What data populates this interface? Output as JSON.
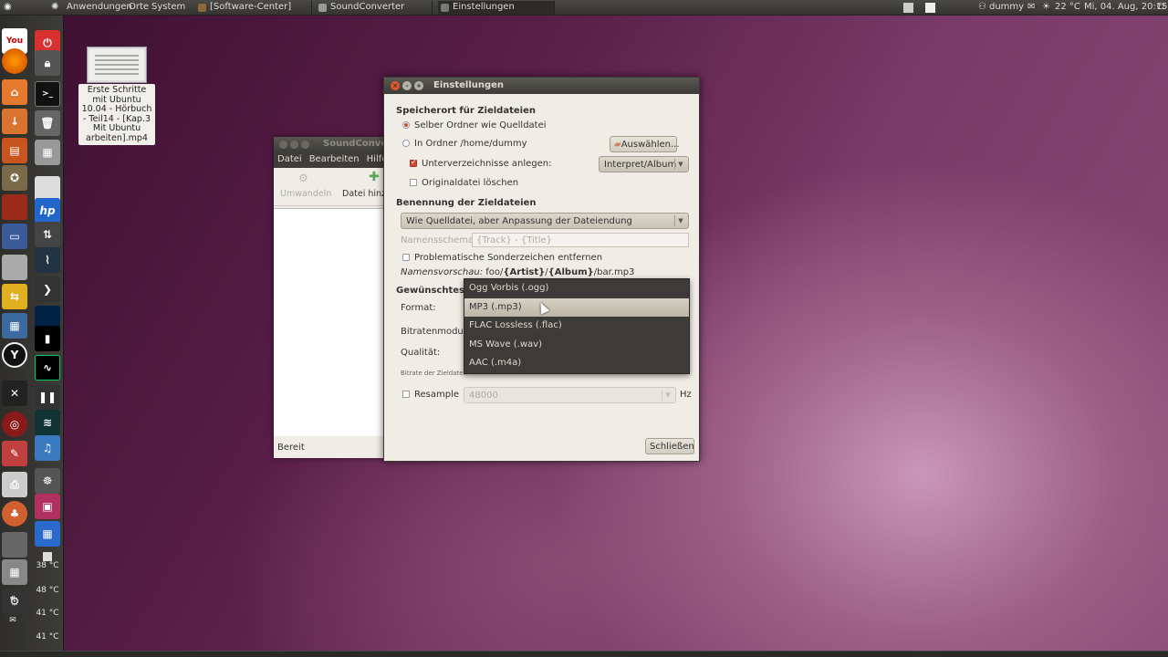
{
  "top_panel": {
    "menus": [
      "Anwendungen",
      "Orte",
      "System"
    ],
    "tasks": [
      {
        "label": "[Software-Center]"
      },
      {
        "label": "SoundConverter"
      },
      {
        "label": "Einstellungen"
      }
    ],
    "user": "dummy",
    "weather": "22 °C",
    "clock": "Mi, 04. Aug, 20:15"
  },
  "dock": {
    "temps": [
      "38 °C",
      "48 °C",
      "41 °C",
      "41 °C"
    ]
  },
  "desktop_file": {
    "label": "Erste Schritte mit Ubuntu 10.04 - Hörbuch - Teil14 - [Kap.3 Mit Ubuntu arbeiten].mp4"
  },
  "sc_window": {
    "title": "SoundConver",
    "menu": [
      "Datei",
      "Bearbeiten",
      "Hilfe"
    ],
    "toolbar": {
      "convert": "Umwandeln",
      "add_file": "Datei hinz"
    },
    "status": "Bereit"
  },
  "dialog": {
    "title": "Einstellungen",
    "target_location": {
      "heading": "Speicherort für Zieldateien",
      "same_folder": "Selber Ordner wie Quelldatei",
      "in_folder": "In Ordner /home/dummy",
      "choose_button": "Auswählen...",
      "create_subfolders": "Unterverzeichnisse anlegen:",
      "subfolder_pattern": "Interpret/Album",
      "delete_original": "Originaldatei löschen"
    },
    "naming": {
      "heading": "Benennung der Zieldateien",
      "scheme_combo": "Wie Quelldatei, aber Anpassung der Dateiendung",
      "scheme_label": "Namensschema:",
      "scheme_value": "{Track} - {Title}",
      "remove_special": "Problematische Sonderzeichen entfernen",
      "preview_label": "Namensvorschau:",
      "preview_prefix": "foo/",
      "preview_artist": "{Artist}",
      "preview_sep": "/",
      "preview_album": "{Album}",
      "preview_suffix": "/bar.mp3"
    },
    "format": {
      "heading_partial": "Gewünschtes Z",
      "format_label": "Format:",
      "bitrate_mode_label": "Bitratenmodus:",
      "quality_label": "Qualität:",
      "bitrate_note": "Bitrate der Zieldatei:",
      "resample_label": "Resample",
      "resample_value": "48000",
      "hz": "Hz"
    },
    "close_button": "Schließen"
  },
  "format_popup": {
    "options": [
      "Ogg Vorbis (.ogg)",
      "MP3 (.mp3)",
      "FLAC Lossless (.flac)",
      "MS Wave (.wav)",
      "AAC (.m4a)"
    ],
    "selected_index": 1
  }
}
